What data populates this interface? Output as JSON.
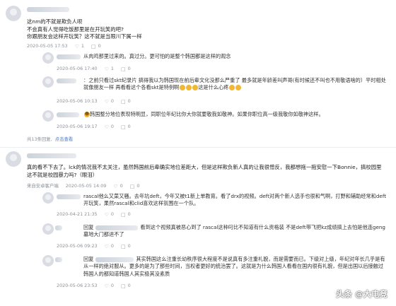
{
  "thread1": {
    "comment_lines": [
      "这nm的不就是欺负人呗",
      "不会真有人觉得吃饭那里是在开玩笑的吧?",
      "你跟朋友会这样开玩笑？这不就是当限川下属一样"
    ],
    "meta": {
      "time": "2020-05-05 17:53",
      "likes": "1",
      "comments": "0"
    },
    "replies": [
      {
        "text": "从肉鸡那里过来的。真过分。更可怕的是整个韩国都是这样的观念",
        "time": "2020-05-06 17:40",
        "likes": "1",
        "comments": "0"
      },
      {
        "name": "：",
        "text": "之前只看过skt纪录片 搞得我以为韩国现在前后辈文化没那么严重了 最多就是年龄差叫声哥(有时候还不叫也不用敬语啥的）平时相处就像朋友一样 再看看这个各看skt是特例啊",
        "tail": "这是什么心疼",
        "time": "2020-05-06 10:13",
        "likes": "0",
        "comments": "0"
      },
      {
        "text": "韩国整分地位表现特明显，同职位年纪比你大你就要敬我如敬神。如果你职位高一级我敬你如敬神这样。",
        "time": "2020-05-06 19:17",
        "likes": "0",
        "comments": "0"
      }
    ],
    "more": {
      "label": "共13条回复,",
      "link": "点击查看"
    }
  },
  "thread2": {
    "comment_lines": [
      "真的看不下去了。lck的情况我不太关注，虽然韩国前后辈确实地位差距大，但是这样欺负新人真的让我很憎反，我都想拖一拖安慰一下Bonnie，搞校园里这不就是校园暴力吗?（眼泪）"
    ],
    "meta": {
      "source": "来自安卓客户端",
      "time": "2020-05-05 14:09",
      "likes": "0",
      "comments": "0"
    },
    "replies": [
      {
        "text": "rascal他么又菜又骚。去年坑deft，今年又被t1新上单教育。看了drx的视频。deft对两个新人选手也很和气啊，打野和辅助经常和deft开玩笑，果然rascal和clid喜欢这样氛围在一个队。",
        "time": "2020-04-21 21:35",
        "likes": "0",
        "comments": "0"
      },
      {
        "prefix": "回复",
        "text": "看到这个视频真被恶心到了 rascal这种叼比不知道有什么资格装 不是deft带飞把kz成绩搞上去怕是他连geng墓地大门都进不了",
        "time": "2020-05-06 09:23",
        "likes": "0",
        "comments": "0"
      },
      {
        "prefix": "回复",
        "text": "其实韩国这么注重长幼秩序很大程度不是说真有多注重礼貌，而是需要而已。下级对上级，年纪对年长几乎是有从一样的绝对服从。更多的是为了那些时间，当权者更好的统治罢了。这就是为什么韩国人看看在国内很有礼貌，但是出国以后接触过韩国人的都知道韩国人其实极其没素质",
        "time": "2020-05-06 23:53",
        "likes": "0",
        "comments": "0"
      }
    ]
  },
  "watermark": "头条 @大电竞",
  "colors": {
    "link": "#4a7bd6",
    "meta": "#8a8f96",
    "divider": "#eceef1"
  },
  "icons": {
    "like": "thumb-up-icon",
    "comment": "comment-icon"
  }
}
